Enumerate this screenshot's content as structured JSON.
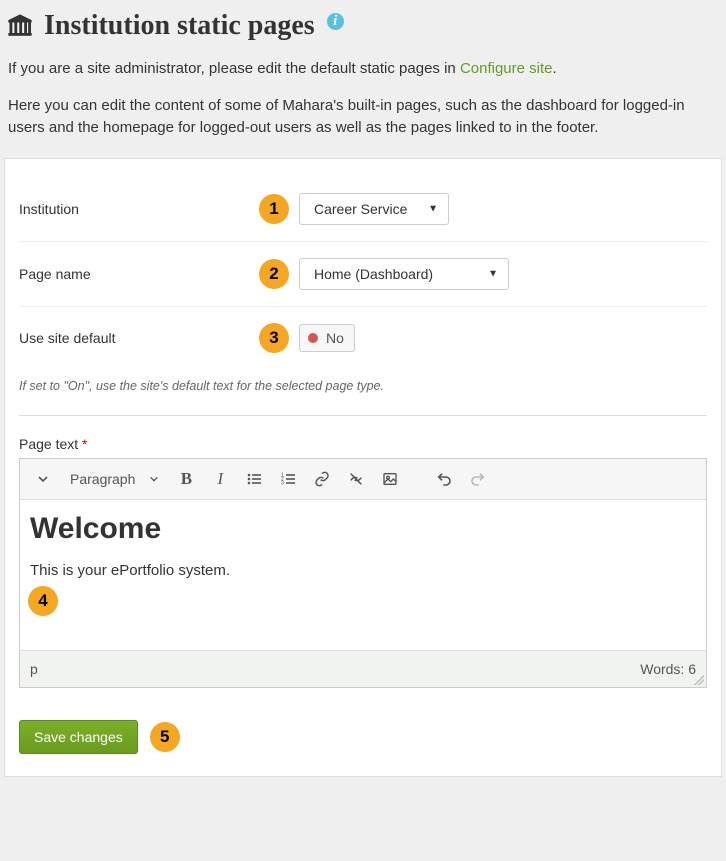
{
  "header": {
    "title": "Institution static pages"
  },
  "intro": {
    "line1_prefix": "If you are a site administrator, please edit the default static pages in ",
    "configure_link": "Configure site",
    "line1_suffix": ".",
    "line2": "Here you can edit the content of some of Mahara's built-in pages, such as the dashboard for logged-in users and the homepage for logged-out users as well as the pages linked to in the footer."
  },
  "badges": {
    "b1": "1",
    "b2": "2",
    "b3": "3",
    "b4": "4",
    "b5": "5"
  },
  "form": {
    "institution": {
      "label": "Institution",
      "value": "Career Service"
    },
    "page_name": {
      "label": "Page name",
      "value": "Home (Dashboard)"
    },
    "use_site_default": {
      "label": "Use site default",
      "value": "No"
    },
    "help_text": "If set to \"On\", use the site's default text for the selected page type.",
    "page_text_label": "Page text",
    "required_mark": "*"
  },
  "editor": {
    "format_label": "Paragraph",
    "content_heading": "Welcome",
    "content_paragraph": "This is your ePortfolio system.",
    "path": "p",
    "word_count_label": "Words: 6"
  },
  "actions": {
    "save": "Save changes"
  }
}
